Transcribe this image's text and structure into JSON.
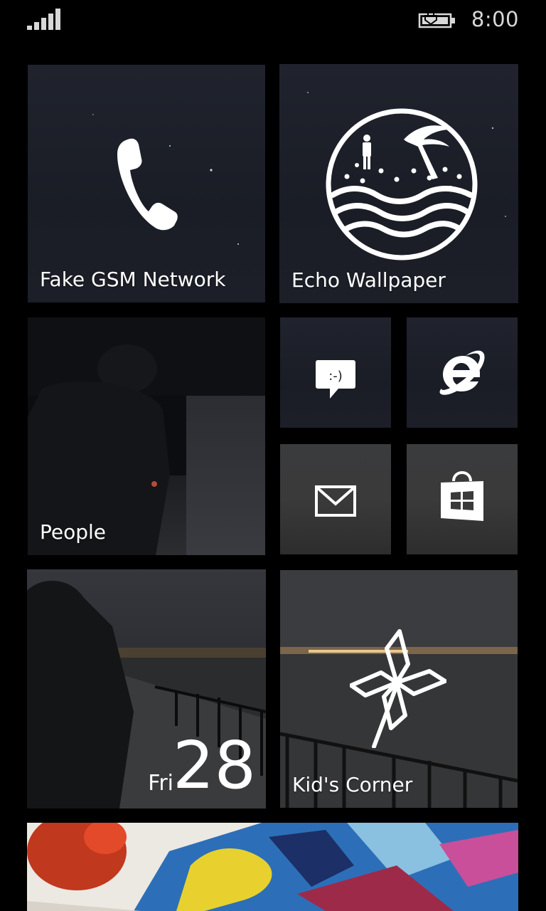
{
  "status_bar": {
    "time": "8:00",
    "signal_icon": "signal-strength-icon",
    "battery_icon": "battery-charging-icon"
  },
  "tiles": {
    "phone": {
      "label": "Fake GSM Network",
      "icon": "phone-icon"
    },
    "echo": {
      "label": "Echo Wallpaper",
      "icon": "beach-circle-icon"
    },
    "people": {
      "label": "People"
    },
    "messaging": {
      "icon": "messaging-icon",
      "glyph": ":-)"
    },
    "ie": {
      "icon": "internet-explorer-icon"
    },
    "mail": {
      "icon": "mail-icon"
    },
    "store": {
      "icon": "store-icon"
    },
    "calendar": {
      "day": "Fri",
      "date": "28"
    },
    "kids_corner": {
      "label": "Kid's Corner",
      "icon": "pinwheel-icon"
    },
    "photos": {
      "icon": "photo-tile"
    }
  },
  "colors": {
    "background": "#000000",
    "tile": "#1b1e27",
    "text": "#ffffff"
  }
}
